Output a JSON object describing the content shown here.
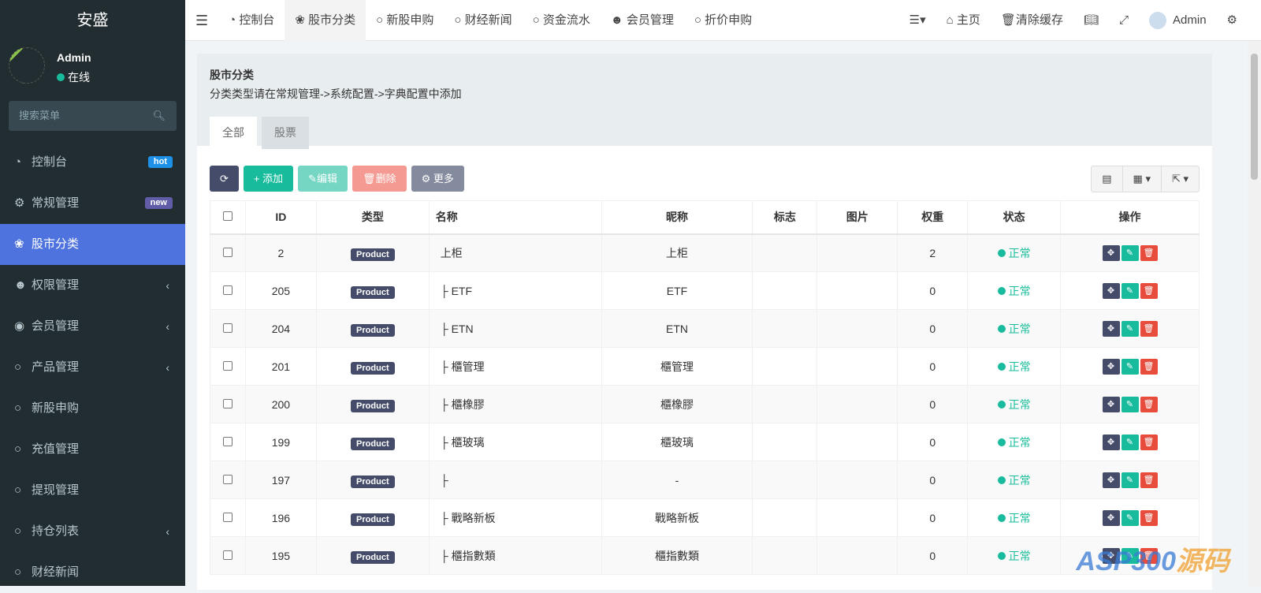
{
  "sidebar": {
    "logo": "安盛",
    "user": "Admin",
    "status": "在线",
    "search_placeholder": "搜索菜单",
    "items": [
      {
        "label": "控制台",
        "icon": "dashboard-icon",
        "badge": "hot",
        "badge_color": "#1e90e8"
      },
      {
        "label": "常规管理",
        "icon": "cogs-icon",
        "badge": "new",
        "badge_color": "#605ca8"
      },
      {
        "label": "股市分类",
        "icon": "leaf-icon",
        "active": true
      },
      {
        "label": "权限管理",
        "icon": "users-icon",
        "chevron": true
      },
      {
        "label": "会员管理",
        "icon": "user-circle-icon",
        "chevron": true
      },
      {
        "label": "产品管理",
        "icon": "circle-icon",
        "chevron": true
      },
      {
        "label": "新股申购",
        "icon": "circle-icon"
      },
      {
        "label": "充值管理",
        "icon": "circle-icon"
      },
      {
        "label": "提现管理",
        "icon": "circle-icon"
      },
      {
        "label": "持仓列表",
        "icon": "circle-icon",
        "chevron": true
      },
      {
        "label": "财经新闻",
        "icon": "circle-icon"
      }
    ]
  },
  "topnav": {
    "tabs": [
      "控制台",
      "股市分类",
      "新股申购",
      "财经新闻",
      "资金流水",
      "会员管理",
      "折价申购"
    ],
    "home": "主页",
    "clear_cache": "清除缓存",
    "user": "Admin"
  },
  "page": {
    "title": "股市分类",
    "desc": "分类类型请在常规管理->系统配置->字典配置中添加",
    "tabs": [
      "全部",
      "股票"
    ]
  },
  "toolbar": {
    "add": "添加",
    "edit": "编辑",
    "delete": "删除",
    "more": "更多"
  },
  "table": {
    "headers": [
      "ID",
      "类型",
      "名称",
      "昵称",
      "标志",
      "图片",
      "权重",
      "状态",
      "操作"
    ],
    "rows": [
      {
        "id": "2",
        "type": "Product",
        "name": "上柜",
        "nickname": "上柜",
        "weight": "2",
        "status": "正常"
      },
      {
        "id": "205",
        "type": "Product",
        "name": "├ ETF",
        "nickname": "ETF",
        "weight": "0",
        "status": "正常"
      },
      {
        "id": "204",
        "type": "Product",
        "name": "├ ETN",
        "nickname": "ETN",
        "weight": "0",
        "status": "正常"
      },
      {
        "id": "201",
        "type": "Product",
        "name": "├ 櫃管理",
        "nickname": "櫃管理",
        "weight": "0",
        "status": "正常"
      },
      {
        "id": "200",
        "type": "Product",
        "name": "├ 櫃橡膠",
        "nickname": "櫃橡膠",
        "weight": "0",
        "status": "正常"
      },
      {
        "id": "199",
        "type": "Product",
        "name": "├ 櫃玻璃",
        "nickname": "櫃玻璃",
        "weight": "0",
        "status": "正常"
      },
      {
        "id": "197",
        "type": "Product",
        "name": "├",
        "nickname": "-",
        "weight": "0",
        "status": "正常"
      },
      {
        "id": "196",
        "type": "Product",
        "name": "├ 戰略新板",
        "nickname": "戰略新板",
        "weight": "0",
        "status": "正常"
      },
      {
        "id": "195",
        "type": "Product",
        "name": "├ 櫃指數類",
        "nickname": "櫃指數類",
        "weight": "0",
        "status": "正常"
      }
    ]
  },
  "watermark": "ASP300源码"
}
